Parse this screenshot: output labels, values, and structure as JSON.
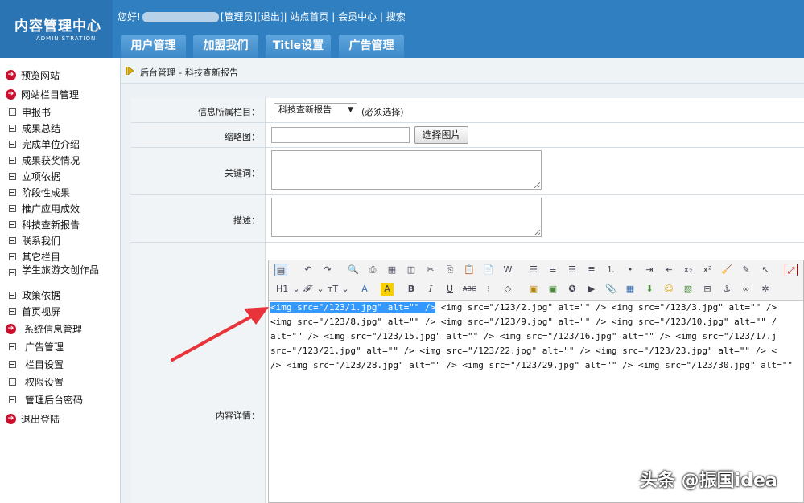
{
  "brand": {
    "title": "内容管理中心",
    "subtitle": "ADMINISTRATION"
  },
  "header": {
    "greeting": "您好!",
    "links": [
      "[管理员]",
      "[退出]",
      "| 站点首页",
      "| 会员中心",
      "| 搜索"
    ],
    "tabs": [
      "用户管理",
      "加盟我们",
      "Title设置",
      "广告管理"
    ]
  },
  "sidebar": {
    "top": [
      {
        "label": "预览网站"
      },
      {
        "label": "网站栏目管理"
      }
    ],
    "column_items": [
      "申报书",
      "成果总结",
      "完成单位介绍",
      "成果获奖情况",
      "立项依据",
      "阶段性成果",
      "推广应用成效",
      "科技查新报告",
      "联系我们",
      "其它栏目",
      "学生旅游文创作品",
      "政策依据",
      "首页视屏"
    ],
    "sys_header": "系统信息管理",
    "sys_items": [
      "广告管理",
      "栏目设置",
      "权限设置",
      "管理后台密码"
    ],
    "logout": "退出登陆"
  },
  "breadcrumb": {
    "root": "后台管理",
    "sep": "-",
    "current": "科技查新报告"
  },
  "form": {
    "category_label": "信息所属栏目：",
    "category_value": "科技查新报告",
    "category_hint": "(必须选择)",
    "thumb_label": "缩略图：",
    "thumb_button": "选择图片",
    "keywords_label": "关键词：",
    "desc_label": "描述：",
    "content_label": "内容详情："
  },
  "editor": {
    "toolbar_row2_drops": [
      "H1",
      "𝓕",
      "тT"
    ],
    "lines": [
      {
        "selected": "<img src=\"/123/1.jpg\" alt=\"\" />",
        "rest": " <img src=\"/123/2.jpg\" alt=\"\" /> <img src=\"/123/3.jpg\" alt=\"\" /> "
      },
      {
        "selected": "",
        "rest": "<img src=\"/123/8.jpg\" alt=\"\" /> <img src=\"/123/9.jpg\" alt=\"\" /> <img src=\"/123/10.jpg\" alt=\"\" /"
      },
      {
        "selected": "",
        "rest": "alt=\"\" /> <img src=\"/123/15.jpg\" alt=\"\" /> <img src=\"/123/16.jpg\" alt=\"\" /> <img src=\"/123/17.j"
      },
      {
        "selected": "",
        "rest": "src=\"/123/21.jpg\" alt=\"\" /> <img src=\"/123/22.jpg\" alt=\"\" /> <img src=\"/123/23.jpg\" alt=\"\" /> <"
      },
      {
        "selected": "",
        "rest": "/> <img src=\"/123/28.jpg\" alt=\"\" /> <img src=\"/123/29.jpg\" alt=\"\" /> <img src=\"/123/30.jpg\" alt=\"\" "
      }
    ]
  },
  "watermark": "头条 @振国idea",
  "colors": {
    "header": "#2f7fc1",
    "accent_red": "#c8102e",
    "selection": "#3399ff",
    "arrow": "#e8333a"
  }
}
